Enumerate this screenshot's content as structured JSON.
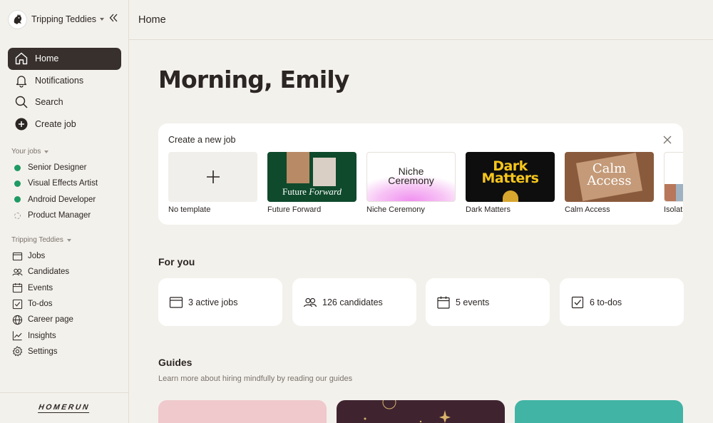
{
  "org": {
    "name": "Tripping Teddies"
  },
  "topbar": {
    "title": "Home"
  },
  "nav": [
    {
      "label": "Home",
      "icon": "home-icon",
      "active": true
    },
    {
      "label": "Notifications",
      "icon": "bell-icon"
    },
    {
      "label": "Search",
      "icon": "search-icon"
    },
    {
      "label": "Create job",
      "icon": "plus-circle-icon"
    }
  ],
  "your_jobs": {
    "label": "Your jobs",
    "items": [
      {
        "label": "Senior Designer",
        "status": "active"
      },
      {
        "label": "Visual Effects Artist",
        "status": "active"
      },
      {
        "label": "Android Developer",
        "status": "active"
      },
      {
        "label": "Product Manager",
        "status": "draft"
      }
    ]
  },
  "org_section": {
    "label": "Tripping Teddies",
    "items": [
      {
        "label": "Jobs",
        "icon": "jobs-icon"
      },
      {
        "label": "Candidates",
        "icon": "candidates-icon"
      },
      {
        "label": "Events",
        "icon": "calendar-icon"
      },
      {
        "label": "To-dos",
        "icon": "checkbox-icon"
      },
      {
        "label": "Career page",
        "icon": "globe-icon"
      },
      {
        "label": "Insights",
        "icon": "chart-icon"
      },
      {
        "label": "Settings",
        "icon": "gear-icon"
      }
    ]
  },
  "brand": "HOMERUN",
  "greeting": "Morning, Emily",
  "create_job": {
    "title": "Create a new job",
    "templates": [
      {
        "label": "No template",
        "thumb_text": ""
      },
      {
        "label": "Future Forward",
        "thumb_text_a": "Future",
        "thumb_text_b": "Forward"
      },
      {
        "label": "Niche Ceremony",
        "thumb_text_a": "Niche",
        "thumb_text_b": "Ceremony"
      },
      {
        "label": "Dark Matters",
        "thumb_text_a": "Dark",
        "thumb_text_b": "Matters"
      },
      {
        "label": "Calm Access",
        "thumb_text_a": "Calm",
        "thumb_text_b": "Access"
      },
      {
        "label": "Isolat",
        "thumb_text": ""
      }
    ]
  },
  "for_you": {
    "title": "For you",
    "stats": [
      {
        "label": "3 active jobs",
        "icon": "jobs-icon"
      },
      {
        "label": "126 candidates",
        "icon": "candidates-icon"
      },
      {
        "label": "5 events",
        "icon": "calendar-icon"
      },
      {
        "label": "6 to-dos",
        "icon": "checkbox-icon"
      }
    ]
  },
  "guides": {
    "title": "Guides",
    "subtitle": "Learn more about hiring mindfully by reading our guides",
    "colors": [
      "#efc9cc",
      "#3f2430",
      "#41b4a5"
    ]
  },
  "colors": {
    "accent_dark": "#38302d",
    "status_green": "#1e9a63",
    "background": "#f3f1ec"
  }
}
